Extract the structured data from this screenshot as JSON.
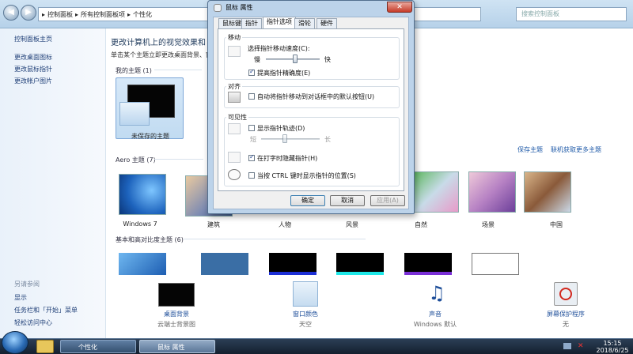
{
  "address": {
    "crumbs": [
      "控制面板",
      "所有控制面板项",
      "个性化"
    ],
    "separator": "▸",
    "search_placeholder": "搜索控制面板"
  },
  "left_pane": {
    "links": [
      "控制面板主页",
      "更改桌面图标",
      "更改鼠标指针",
      "更改帐户图片"
    ],
    "see_also_title": "另请参阅",
    "see_also": [
      "显示",
      "任务栏和「开始」菜单",
      "轻松访问中心"
    ]
  },
  "main": {
    "heading": "更改计算机上的视觉效果和",
    "subheading": "单击某个主题立即更改桌面背景、窗",
    "my_themes_header": "我的主题 (1)",
    "unsaved_theme": "未保存的主题",
    "save_theme": "保存主题",
    "more_themes": "联机获取更多主题",
    "aero_header": "Aero 主题 (7)",
    "aero_themes": [
      "Windows 7",
      "建筑",
      "人物",
      "风景",
      "自然",
      "场景",
      "中国"
    ],
    "basic_header": "基本和高对比度主题 (6)"
  },
  "bottom": [
    {
      "label": "桌面背景",
      "value": "云端士背景图"
    },
    {
      "label": "窗口颜色",
      "value": "天空"
    },
    {
      "label": "声音",
      "value": "Windows 默认"
    },
    {
      "label": "屏幕保护程序",
      "value": "无"
    }
  ],
  "dialog": {
    "title": "鼠标 属性",
    "close_glyph": "✕",
    "tabs": [
      "鼠标键",
      "指针",
      "指针选项",
      "滑轮",
      "硬件"
    ],
    "active_tab": 2,
    "motion": {
      "group": "移动",
      "speed_label": "选择指针移动速度(C):",
      "slow": "慢",
      "fast": "快",
      "speed_level": 0.55,
      "precision_label": "提高指针精确度(E)",
      "precision_checked": true
    },
    "snap": {
      "group": "对齐",
      "label": "自动将指针移动到对话框中的默认按钮(U)",
      "checked": false
    },
    "visibility": {
      "group": "可见性",
      "trails_label": "显示指针轨迹(D)",
      "trails_checked": false,
      "short": "短",
      "long": "长",
      "trail_level": 0.4,
      "hide_label": "在打字时隐藏指针(H)",
      "hide_checked": true,
      "ctrl_label": "当按 CTRL 键时显示指针的位置(S)",
      "ctrl_checked": false
    },
    "buttons": {
      "ok": "确定",
      "cancel": "取消",
      "apply": "应用(A)"
    }
  },
  "taskbar": {
    "items": [
      "个性化",
      "鼠标 属性"
    ],
    "time": "15:15",
    "date": "2018/6/25"
  }
}
